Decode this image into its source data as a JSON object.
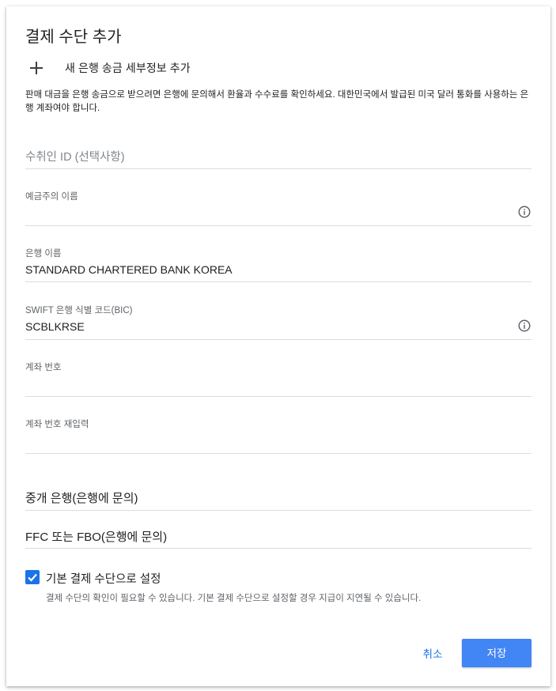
{
  "dialog": {
    "title": "결제 수단 추가",
    "add_bank": {
      "label": "새 은행 송금 세부정보 추가",
      "icon": "plus-icon"
    },
    "description": "판매 대금을 은행 송금으로 받으려면 은행에 문의해서 환율과 수수료를 확인하세요. 대한민국에서 발급된 미국 달러 통화를 사용하는 은행 계좌여야 합니다."
  },
  "fields": {
    "payee_id": {
      "placeholder": "수취인 ID (선택사항)",
      "value": ""
    },
    "account_holder": {
      "label": "예금주의 이름",
      "value": "",
      "icon": "info-icon"
    },
    "bank_name": {
      "label": "은행 이름",
      "value": "STANDARD CHARTERED BANK KOREA"
    },
    "swift": {
      "label": "SWIFT 은행 식별 코드(BIC)",
      "value": "SCBLKRSE",
      "icon": "info-icon"
    },
    "account_number": {
      "label": "계좌 번호",
      "value": ""
    },
    "account_number_confirm": {
      "label": "계좌 번호 재입력",
      "value": ""
    },
    "intermediary_bank": {
      "value": "중개 은행(은행에 문의)"
    },
    "ffc_fbo": {
      "value": "FFC 또는 FBO(은행에 문의)"
    }
  },
  "default_payment": {
    "checked": true,
    "label": "기본 결제 수단으로 설정",
    "help": "결제 수단의 확인이 필요할 수 있습니다. 기본 결제 수단으로 설정할 경우 지급이 지연될 수 있습니다."
  },
  "buttons": {
    "cancel": "취소",
    "save": "저장"
  },
  "colors": {
    "accent": "#1a73e8",
    "primary_button": "#4285f4",
    "divider": "#dadce0",
    "label": "#5f6368"
  }
}
